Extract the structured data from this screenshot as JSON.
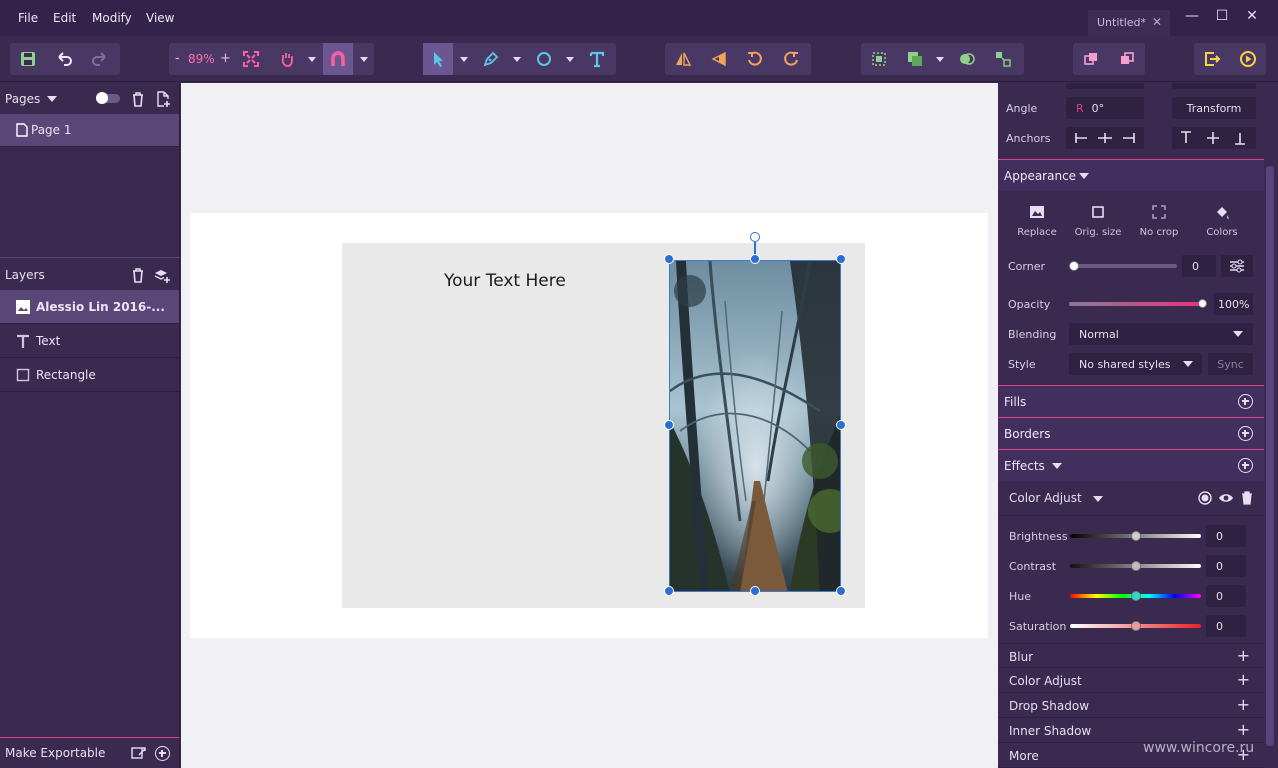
{
  "menu": {
    "file": "File",
    "edit": "Edit",
    "modify": "Modify",
    "view": "View"
  },
  "document": {
    "tab_title": "Untitled*",
    "close": "✕"
  },
  "window": {
    "minimize": "—",
    "maximize": "☐",
    "close": "✕"
  },
  "toolbar": {
    "zoom_minus": "-",
    "zoom_value": "89%",
    "zoom_plus": "+"
  },
  "pages": {
    "title": "Pages",
    "items": [
      {
        "label": "Page 1"
      }
    ]
  },
  "layers": {
    "title": "Layers",
    "items": [
      {
        "label": "Alessio Lin 2016-...",
        "type": "image-icon"
      },
      {
        "label": "Text",
        "type": "text-icon"
      },
      {
        "label": "Rectangle",
        "type": "rectangle-icon"
      }
    ]
  },
  "export": {
    "label": "Make Exportable"
  },
  "canvas": {
    "text": "Your Text Here"
  },
  "inspector": {
    "angle_label": "Angle",
    "angle_prefix": "R",
    "angle_value": "0°",
    "transform_label": "Transform",
    "anchors_label": "Anchors",
    "appearance": {
      "title": "Appearance",
      "tools": [
        "Replace",
        "Orig. size",
        "No crop",
        "Colors"
      ],
      "corner_label": "Corner",
      "corner_value": "0",
      "corner_fraction": 0,
      "opacity_label": "Opacity",
      "opacity_value": "100%",
      "opacity_fraction": 1,
      "blending_label": "Blending",
      "blending_value": "Normal",
      "style_label": "Style",
      "style_value": "No shared styles",
      "sync_label": "Sync"
    },
    "fills_title": "Fills",
    "borders_title": "Borders",
    "effects": {
      "title": "Effects",
      "color_adjust_title": "Color Adjust",
      "brightness_label": "Brightness",
      "brightness_value": "0",
      "contrast_label": "Contrast",
      "contrast_value": "0",
      "hue_label": "Hue",
      "hue_value": "0",
      "saturation_label": "Saturation",
      "saturation_value": "0",
      "add_list": [
        "Blur",
        "Color Adjust",
        "Drop Shadow",
        "Inner Shadow",
        "More"
      ]
    }
  },
  "watermark": "www.wincore.ru",
  "colors": {
    "accent": "#d9437f",
    "selection": "#2d6fd1",
    "panel": "#3b2a50"
  }
}
